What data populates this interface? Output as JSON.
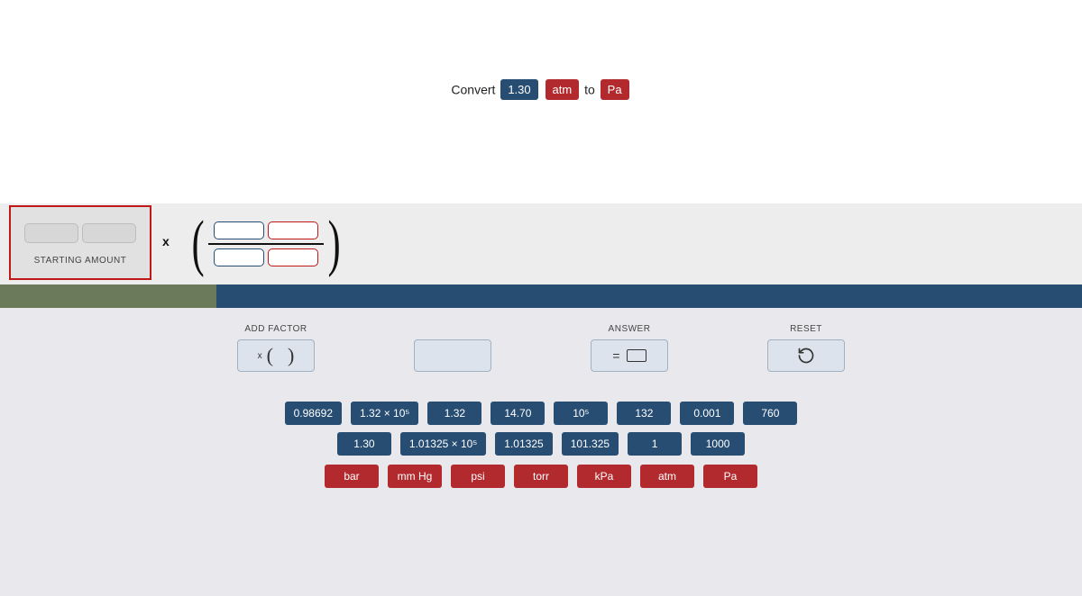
{
  "prompt": {
    "prefix": "Convert",
    "value": "1.30",
    "from_unit": "atm",
    "middle": "to",
    "to_unit": "Pa"
  },
  "starting": {
    "label": "STARTING AMOUNT"
  },
  "controls": {
    "add_factor": "ADD FACTOR",
    "answer": "ANSWER",
    "reset": "RESET"
  },
  "value_tiles_row1": [
    "0.98692",
    "1.32 × 10⁵",
    "1.32",
    "14.70",
    "10⁵",
    "132",
    "0.001",
    "760"
  ],
  "value_tiles_row2": [
    "1.30",
    "1.01325 × 10⁵",
    "1.01325",
    "101.325",
    "1",
    "1000"
  ],
  "unit_tiles": [
    "bar",
    "mm Hg",
    "psi",
    "torr",
    "kPa",
    "atm",
    "Pa"
  ]
}
